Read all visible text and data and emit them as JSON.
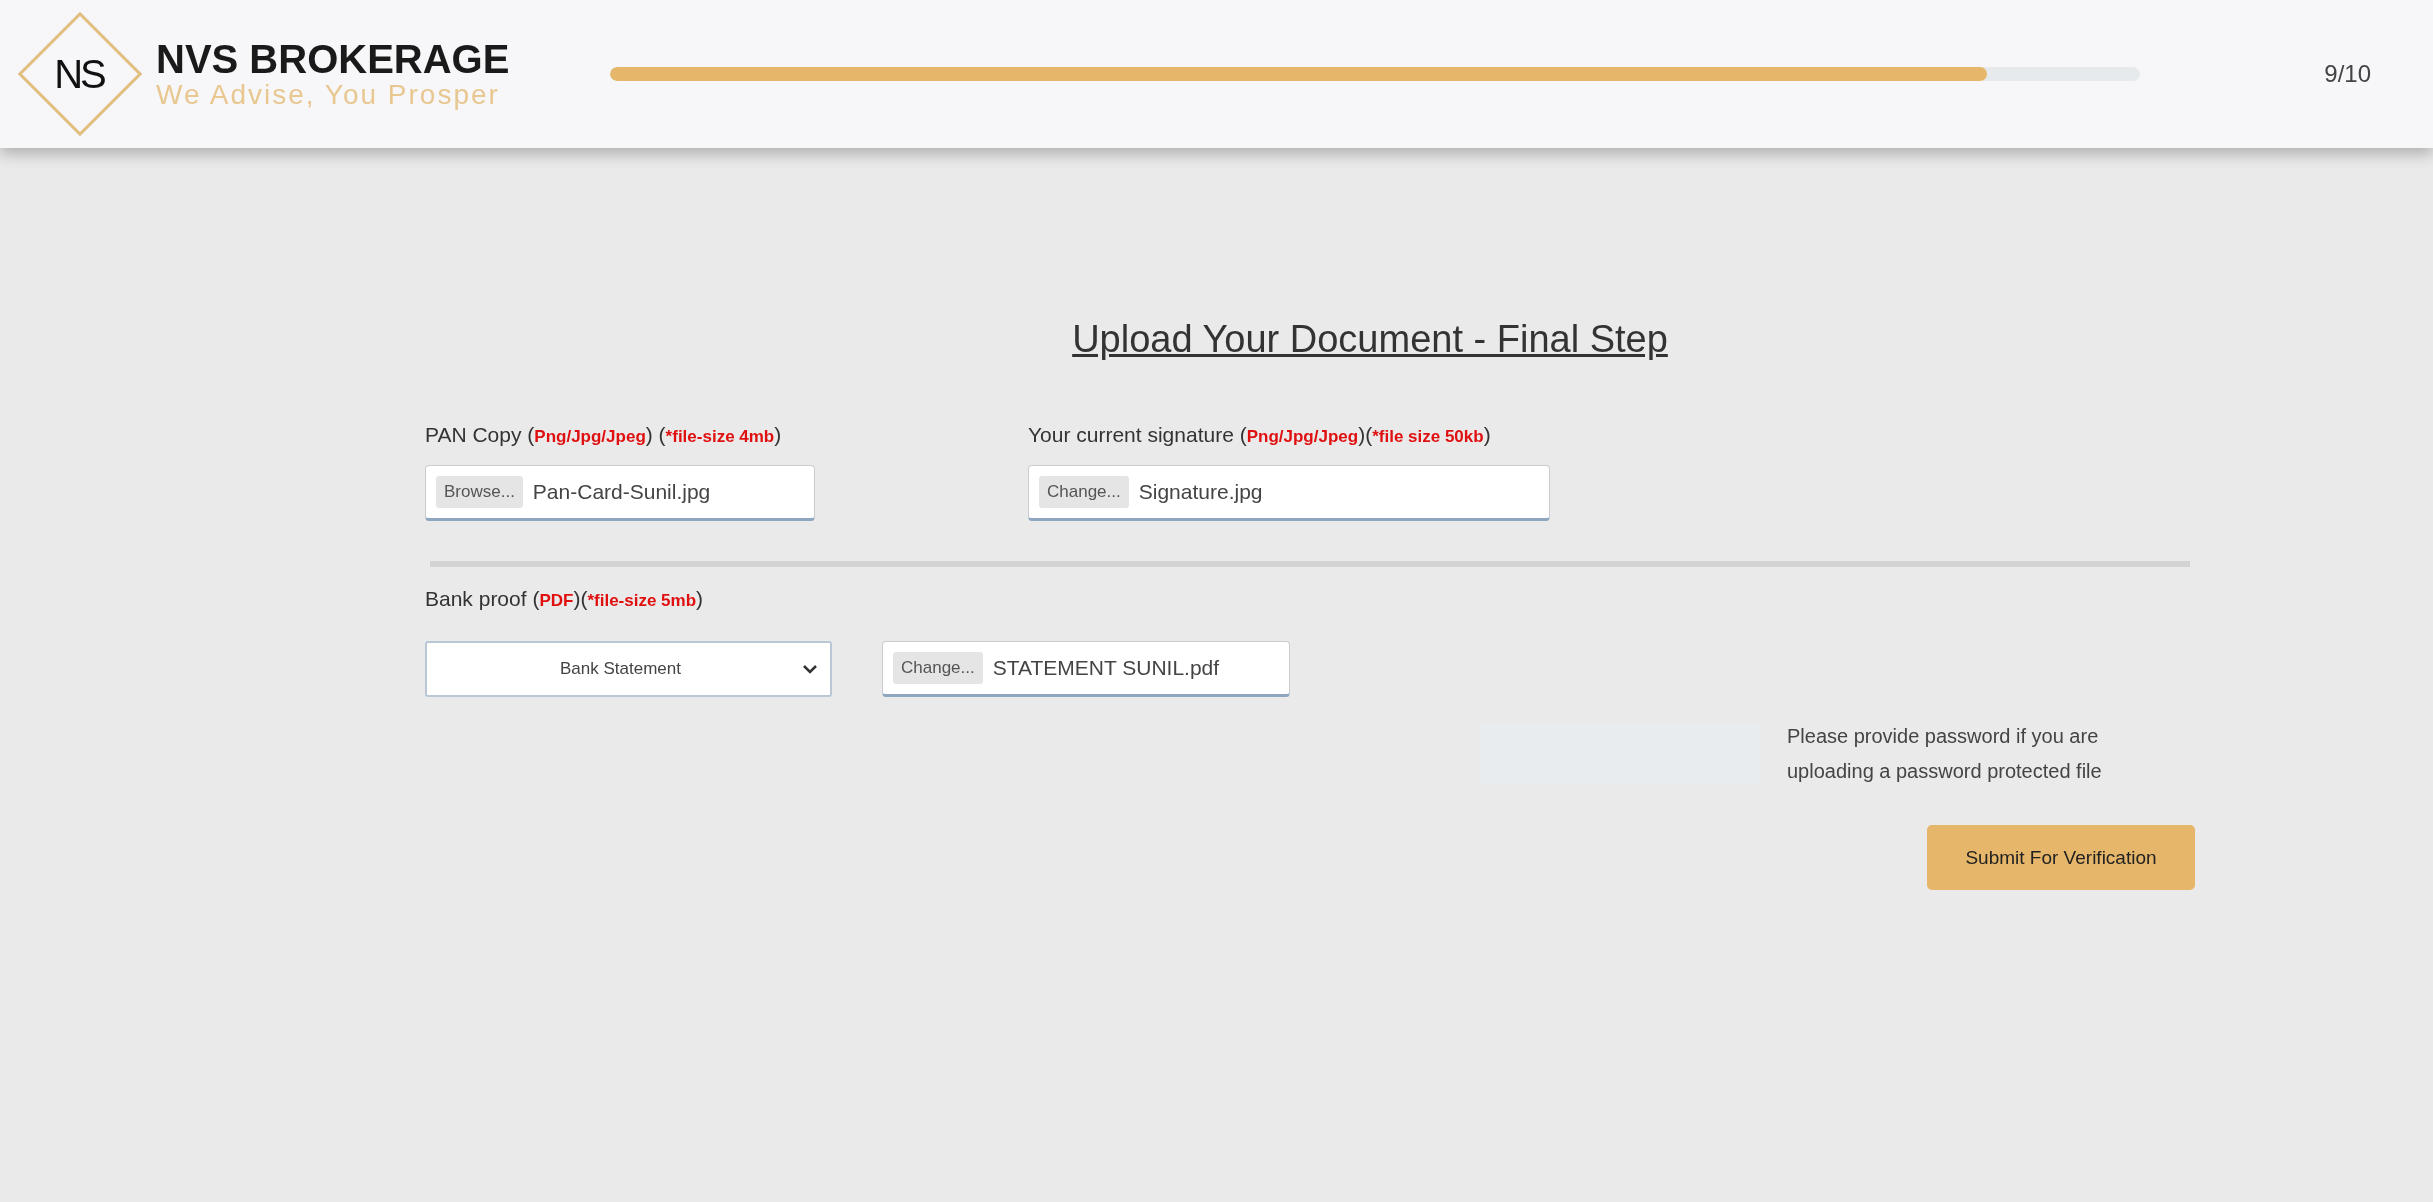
{
  "header": {
    "logo": {
      "monogram": "NS",
      "name": "NVS BROKERAGE",
      "tagline": "We Advise, You Prosper"
    },
    "progress": {
      "level": 0.9,
      "reading": "9/10"
    }
  },
  "title": "Upload Your Document - Final Step",
  "upload_rows": [
    {
      "fields": [
        {
          "label_parts": [
            {
              "kind": "plain",
              "text": "PAN Copy ("
            },
            {
              "kind": "note",
              "text": "Png/Jpg/Jpeg"
            },
            {
              "kind": "plain",
              "text": ") ("
            },
            {
              "kind": "note",
              "text": "*file-size 4mb"
            },
            {
              "kind": "plain",
              "text": ")"
            }
          ],
          "button": "Browse...",
          "file": "Pan-Card-Sunil.jpg"
        },
        {
          "label_parts": [
            {
              "kind": "plain",
              "text": "Your current signature ("
            },
            {
              "kind": "note",
              "text": "Png/Jpg/Jpeg"
            },
            {
              "kind": "plain",
              "text": ")("
            },
            {
              "kind": "note",
              "text": "*file size 50kb"
            },
            {
              "kind": "plain",
              "text": ")"
            }
          ],
          "button": "Change...",
          "file": "Signature.jpg"
        }
      ]
    }
  ],
  "bank": {
    "label_parts": [
      {
        "kind": "plain",
        "text": "Bank proof ("
      },
      {
        "kind": "note",
        "text": "PDF"
      },
      {
        "kind": "plain",
        "text": ")("
      },
      {
        "kind": "note",
        "text": "*file-size 5mb"
      },
      {
        "kind": "plain",
        "text": ")"
      }
    ],
    "select_value": "Bank Statement",
    "button": "Change...",
    "file": "STATEMENT SUNIL.pdf"
  },
  "password": {
    "help": "Please provide password if you are uploading a password protected file"
  },
  "submit": "Submit For Verification"
}
